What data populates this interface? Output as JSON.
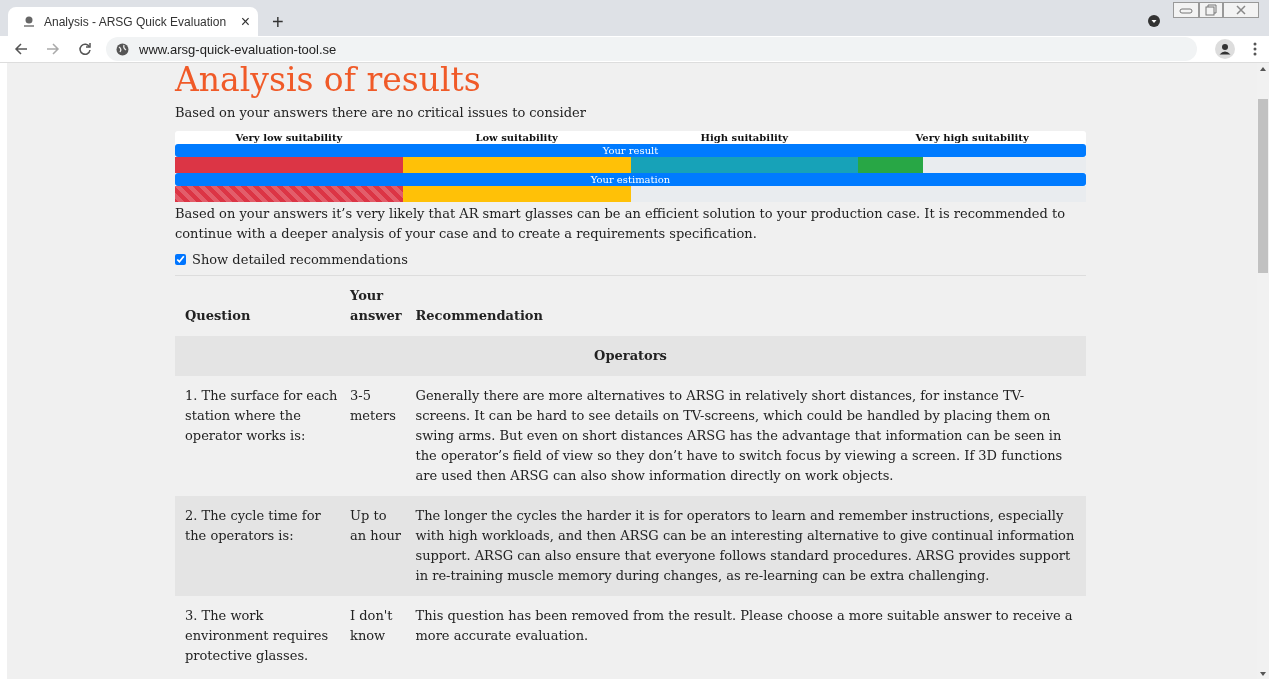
{
  "browser": {
    "tab_title": "Analysis - ARSG Quick Evaluation",
    "tab_close": "×",
    "new_tab": "+",
    "url": "www.arsg-quick-evaluation-tool.se"
  },
  "page": {
    "title": "Analysis of results",
    "critical_note": "Based on your answers there are no critical issues to consider",
    "scale": [
      "Very low suitability",
      "Low suitability",
      "High suitability",
      "Very high suitability"
    ],
    "bars": [
      {
        "label": "Your result",
        "kind": "solid",
        "level": 0.821,
        "segments": [
          {
            "color": "#dc3545"
          },
          {
            "color": "#ffc107"
          },
          {
            "color": "#17a2b8"
          },
          {
            "color": "#28a745"
          }
        ]
      },
      {
        "label": "Your estimation",
        "kind": "striped",
        "level": 0.5,
        "segments": [
          {
            "color": "#dc3545"
          },
          {
            "color": "#ffc107"
          }
        ]
      }
    ],
    "summary": "Based on your answers it’s very likely that AR smart glasses can be an efficient solution to your production case. It is recommended to continue with a deeper analysis of your case and to create a requirements specification.",
    "show_details": {
      "label": "Show detailed recommendations",
      "checked": true
    },
    "table": {
      "columns": [
        "Question",
        "Your answer",
        "Recommendation"
      ],
      "sections": [
        {
          "title": "Operators",
          "rows": [
            {
              "question": "1. The surface for each station where the operator works is:",
              "answer": "3-5 meters",
              "recommendation": "Generally there are more alternatives to ARSG in relatively short distances, for instance TV-screens. It can be hard to see details on TV-screens, which could be handled by placing them on swing arms. But even on short distances ARSG has the advantage that information can be seen in the operator’s field of view so they don’t have to switch focus by viewing a screen. If 3D functions are used then ARSG can also show information directly on work objects."
            },
            {
              "question": "2. The cycle time for the operators is:",
              "answer": "Up to an hour",
              "recommendation": "The longer the cycles the harder it is for operators to learn and remember instructions, especially with high workloads, and then ARSG can be an interesting alternative to give continual information support. ARSG can also ensure that everyone follows standard procedures. ARSG provides support in re-training muscle memory during changes, as re-learning can be extra challenging."
            },
            {
              "question": "3. The work environment requires protective glasses.",
              "answer": "I don't know",
              "recommendation": "This question has been removed from the result. Please choose a more suitable answer to receive a more accurate evaluation."
            }
          ]
        }
      ]
    }
  }
}
